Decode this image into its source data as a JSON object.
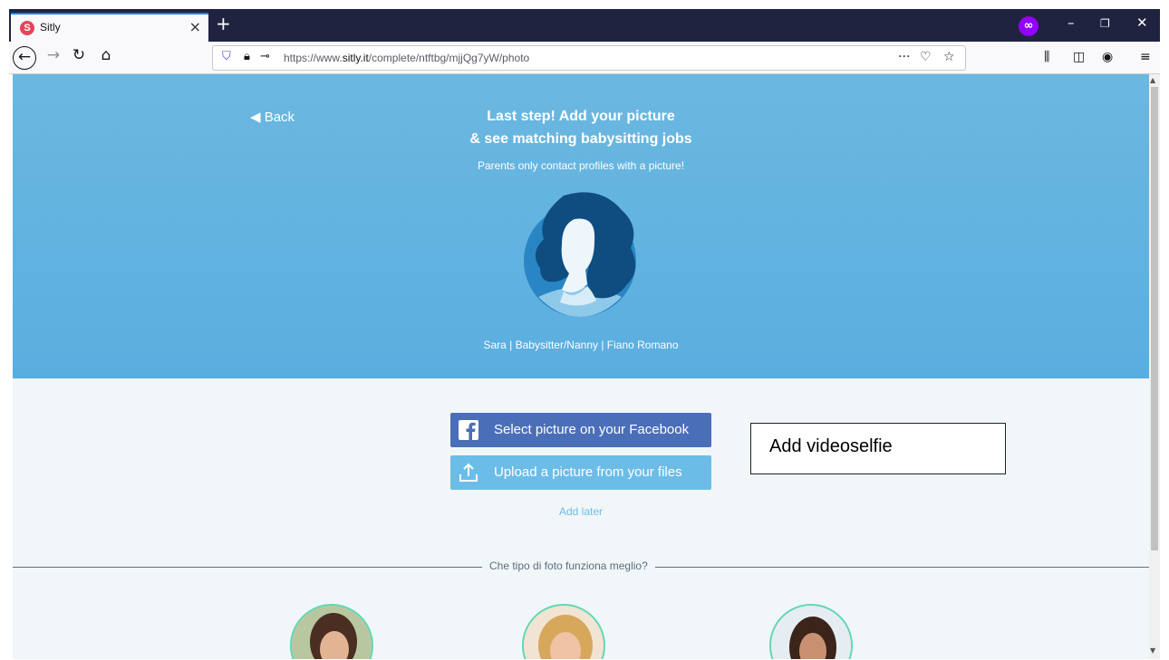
{
  "browser": {
    "tab_title": "Sitly",
    "tab_favicon_letter": "S",
    "tab_close": "×",
    "new_tab": "+",
    "url_prefix": "https://www.",
    "url_domain": "sitly.it",
    "url_path": "/complete/ntftbg/mjjQg7yW/photo",
    "page_actions": "···",
    "icons": [
      "back-icon",
      "forward-icon",
      "reload-icon",
      "home-icon",
      "shield-icon",
      "lock-icon",
      "key-icon",
      "pocket-icon",
      "star-icon",
      "library-icon",
      "sidebar-icon",
      "account-icon",
      "menu-icon",
      "private-mask-icon"
    ]
  },
  "page": {
    "back_label": "Back",
    "title_line1": "Last step! Add your picture",
    "title_line2": "& see matching babysitting jobs",
    "subtitle": "Parents only contact profiles with a picture!",
    "profile_line": "Sara | Babysitter/Nanny | Fiano Romano",
    "facebook_button": "Select picture on your Facebook",
    "upload_button": "Upload a picture from your files",
    "add_later": "Add later",
    "divider_label": "Che tipo di foto funziona meglio?",
    "video_selfie": "Add videoselfie"
  },
  "colors": {
    "hero": "#5aaedf",
    "facebook": "#4a6fb8",
    "upload": "#6bbde8",
    "photo_ring": "#5fd8b3"
  }
}
